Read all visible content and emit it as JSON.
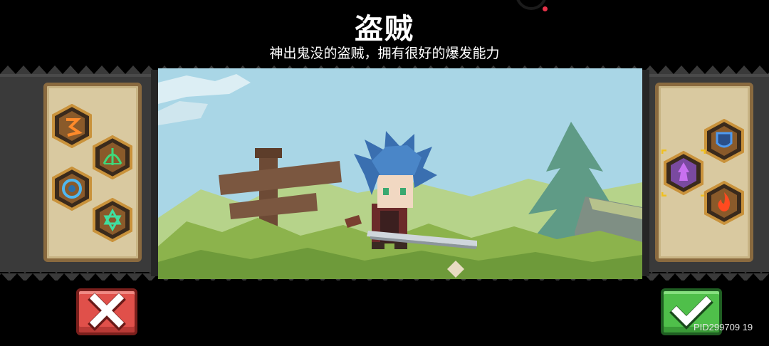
{
  "character": {
    "name": "盗贼",
    "description": "神出鬼没的盗贼，拥有很好的爆发能力"
  },
  "left_skills": [
    {
      "icon": "dash-rune-icon",
      "color": "#e07a2a"
    },
    {
      "icon": "bow-arrow-icon",
      "color": "#3fb86a"
    },
    {
      "icon": "swirl-vortex-icon",
      "color": "#3fa0d8"
    },
    {
      "icon": "hexagram-star-icon",
      "color": "#3fc08a"
    }
  ],
  "right_skills": [
    {
      "icon": "shield-icon",
      "color": "#3f7fd8"
    },
    {
      "icon": "dark-flame-icon",
      "color": "#b040d0",
      "selected": true
    },
    {
      "icon": "fire-icon",
      "color": "#e04020"
    }
  ],
  "buttons": {
    "cancel_icon": "close-x-icon",
    "confirm_icon": "checkmark-icon"
  },
  "footer": {
    "pid": "PID299709  19"
  }
}
